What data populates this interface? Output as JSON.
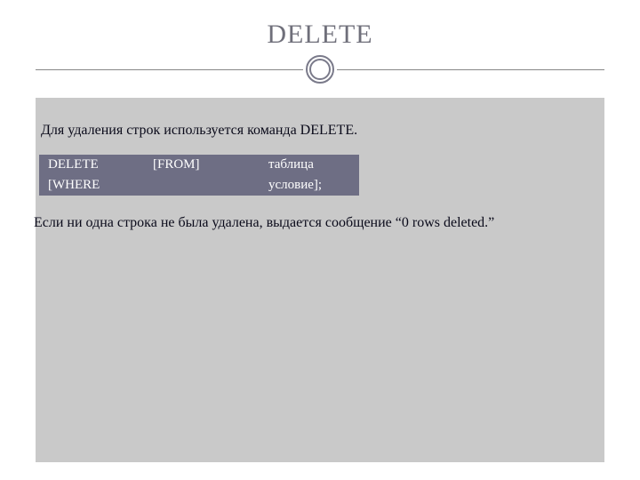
{
  "title": "DELETE",
  "intro": "Для удаления строк используется команда DELETE.",
  "syntax": {
    "row1": {
      "c1": "DELETE",
      "c2": "[FROM]",
      "c3": "таблица"
    },
    "row2": {
      "c1": "[WHERE",
      "c2": "",
      "c3": "условие];"
    }
  },
  "outro": "Если ни одна строка не была удалена, выдается сообщение “0 rows deleted.”"
}
